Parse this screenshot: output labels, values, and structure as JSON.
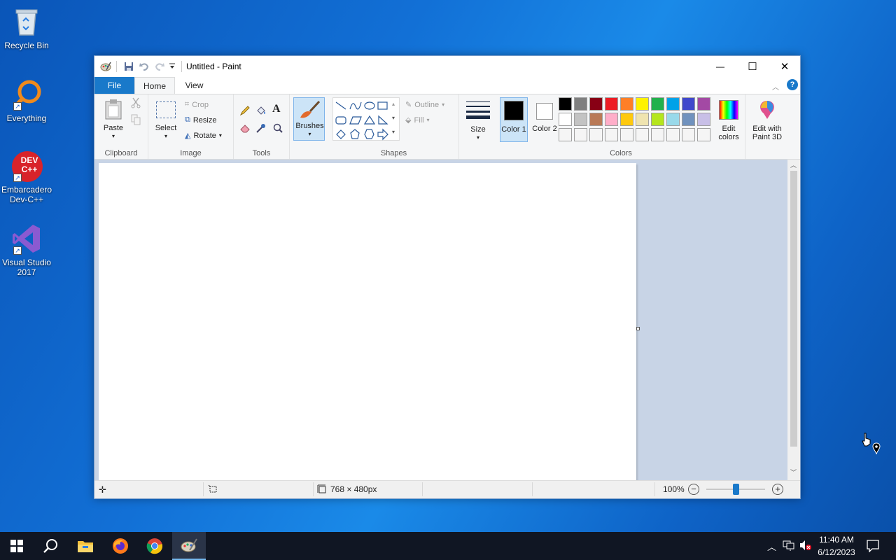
{
  "desktop": {
    "icons": [
      {
        "label": "Recycle Bin",
        "icon": "recycle-bin-icon"
      },
      {
        "label": "Everything",
        "icon": "everything-search-icon"
      },
      {
        "label": "Embarcadero Dev-C++",
        "icon": "devcpp-icon",
        "badge": "DEV C++"
      },
      {
        "label": "Visual Studio 2017",
        "icon": "visual-studio-icon"
      }
    ]
  },
  "window": {
    "title": "Untitled - Paint",
    "controls": {
      "minimize": "—",
      "maximize": "☐",
      "close": "✕"
    }
  },
  "tabs": [
    {
      "label": "File",
      "active": false
    },
    {
      "label": "Home",
      "active": true
    },
    {
      "label": "View",
      "active": false
    }
  ],
  "ribbon": {
    "clipboard": {
      "label": "Clipboard",
      "paste": "Paste"
    },
    "image": {
      "label": "Image",
      "select": "Select",
      "crop": "Crop",
      "resize": "Resize",
      "rotate": "Rotate"
    },
    "tools": {
      "label": "Tools"
    },
    "brushes": {
      "label": "Brushes"
    },
    "shapes": {
      "label": "Shapes",
      "outline": "Outline",
      "fill": "Fill"
    },
    "size": {
      "label": "Size"
    },
    "colors": {
      "label": "Colors",
      "color1": "Color 1",
      "color2": "Color 2",
      "color1_value": "#000000",
      "color2_value": "#ffffff",
      "edit_colors": "Edit colors",
      "palette_row1": [
        "#000000",
        "#7f7f7f",
        "#880015",
        "#ed1c24",
        "#ff7f27",
        "#fff200",
        "#22b14c",
        "#00a2e8",
        "#3f48cc",
        "#a349a4"
      ],
      "palette_row2": [
        "#ffffff",
        "#c3c3c3",
        "#b97a57",
        "#ffaec9",
        "#ffc90e",
        "#efe4b0",
        "#b5e61d",
        "#99d9ea",
        "#7092be",
        "#c8bfe7"
      ],
      "palette_row3": [
        "#f5f5f5",
        "#f5f5f5",
        "#f5f5f5",
        "#f5f5f5",
        "#f5f5f5",
        "#f5f5f5",
        "#f5f5f5",
        "#f5f5f5",
        "#f5f5f5",
        "#f5f5f5"
      ]
    },
    "paint3d": {
      "label": "Edit with Paint 3D"
    }
  },
  "status": {
    "dimensions": "768 × 480px",
    "zoom": "100%",
    "zoom_level": 0.5
  },
  "taskbar": {
    "time": "11:40 AM",
    "date": "6/12/2023"
  },
  "accent": "#1979ca"
}
